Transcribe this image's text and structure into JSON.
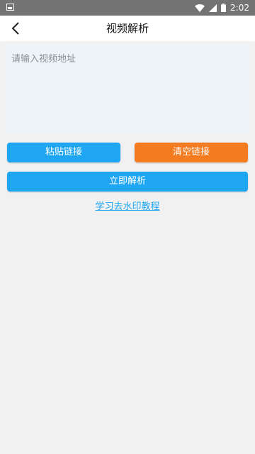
{
  "status_bar": {
    "time": "2:02",
    "icons": [
      "notification-icon",
      "wifi-icon",
      "signal-icon",
      "battery-icon"
    ]
  },
  "header": {
    "title": "视频解析",
    "back_icon": "chevron-left-icon"
  },
  "main": {
    "url_input": {
      "placeholder": "请输入视频地址",
      "value": ""
    },
    "paste_label": "粘贴链接",
    "clear_label": "清空链接",
    "parse_label": "立即解析",
    "tutorial_link": "学习去水印教程"
  },
  "colors": {
    "primary": "#1ea6f3",
    "accent": "#f47b20",
    "status_bar": "#737373",
    "background": "#f1f1f1"
  }
}
